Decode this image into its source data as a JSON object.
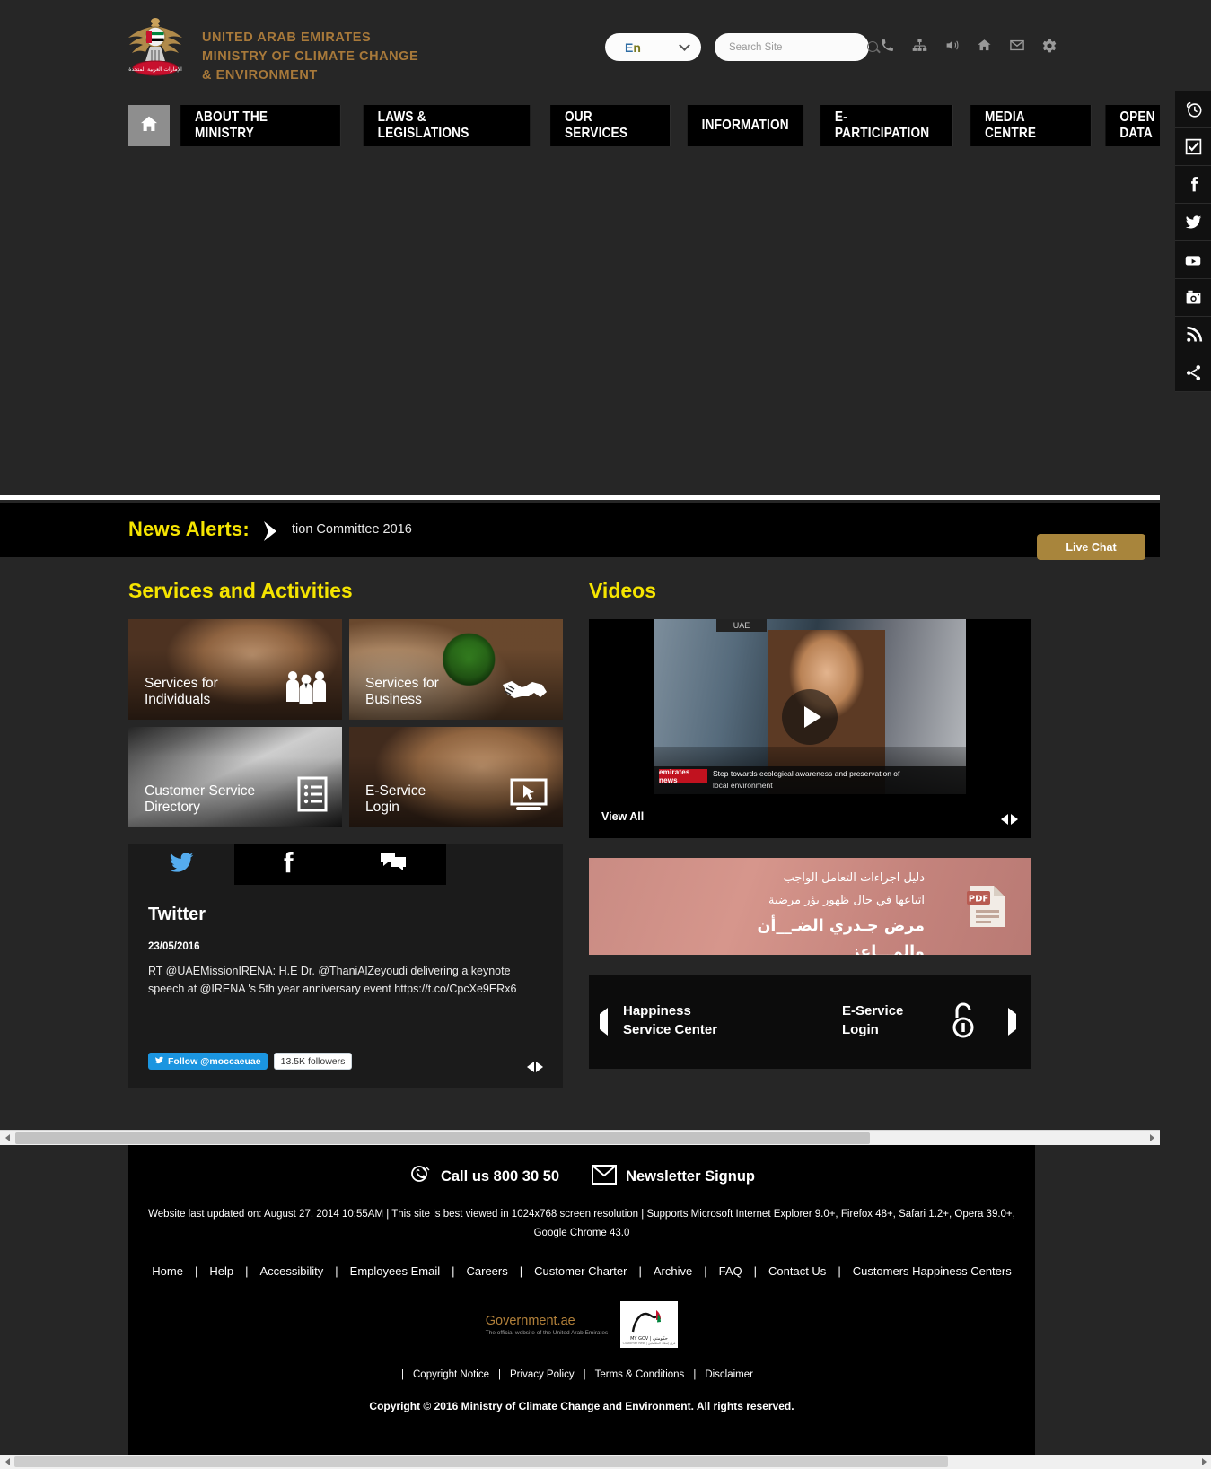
{
  "header": {
    "org_line1": "UNITED ARAB EMIRATES",
    "org_line2": "MINISTRY OF CLIMATE CHANGE",
    "org_line3": "& ENVIRONMENT",
    "language": "En",
    "language_e": "En",
    "search_placeholder": "Search Site",
    "search_value": "",
    "icons": [
      "phone-icon",
      "sitemap-icon",
      "accessibility-speaker-icon",
      "home-icon",
      "email-icon",
      "settings-gear-icon"
    ]
  },
  "nav": {
    "home_icon": "home-icon",
    "items": [
      {
        "label": "ABOUT THE MINISTRY"
      },
      {
        "label": "LAWS & LEGISLATIONS"
      },
      {
        "label": "OUR SERVICES"
      },
      {
        "label": "INFORMATION"
      },
      {
        "label": "E-PARTICIPATION"
      },
      {
        "label": "MEDIA CENTRE"
      },
      {
        "label": "OPEN DATA"
      }
    ]
  },
  "social_rail": [
    {
      "name": "prayer-times-clock-icon"
    },
    {
      "name": "survey-checkbox-icon"
    },
    {
      "name": "facebook-icon"
    },
    {
      "name": "twitter-icon"
    },
    {
      "name": "youtube-icon"
    },
    {
      "name": "instagram-icon"
    },
    {
      "name": "rss-icon"
    },
    {
      "name": "share-icon"
    }
  ],
  "news_alerts": {
    "label": "News Alerts:",
    "ticker_text": "tion Committee 2016",
    "live_chat": "Live Chat"
  },
  "services": {
    "title": "Services and Activities",
    "tiles": [
      {
        "line1": "Services for",
        "line2": "Individuals",
        "icon": "people-group-icon",
        "bg": "bg-hands-kb"
      },
      {
        "line1": "Services for",
        "line2": "Business",
        "icon": "handshake-icon",
        "bg": "bg-globe"
      },
      {
        "line1": "Customer Service",
        "line2": "Directory",
        "icon": "list-document-icon",
        "bg": "bg-kbpoint"
      },
      {
        "line1": "E-Service",
        "line2": "Login",
        "icon": "monitor-cursor-icon",
        "bg": "bg-hands-kb2"
      }
    ]
  },
  "social_widget": {
    "tabs": [
      {
        "icon": "twitter-icon",
        "active": true
      },
      {
        "icon": "facebook-icon",
        "active": false
      },
      {
        "icon": "chat-bubbles-icon",
        "active": false
      }
    ],
    "title": "Twitter",
    "date": "23/05/2016",
    "tweet": "RT @UAEMissionIRENA: H.E Dr. @ThaniAlZeyoudi delivering a keynote speech at @IRENA 's 5th year anniversary event https://t.co/CpcXe9ERx6",
    "follow_label": "Follow @moccaeuae",
    "followers": "13.5K followers"
  },
  "videos": {
    "title": "Videos",
    "view_all": "View All",
    "play_icon": "play-icon",
    "ticker_channel": "emirates news",
    "ticker_line1": "Step towards ecological awareness and preservation of",
    "ticker_line2": "local environment",
    "top_label": "UAE"
  },
  "pdf_banner": {
    "line1": "دليل اجراءات التعامل الواجب",
    "line2": "اتباعها في حال ظهور بؤر مرضية",
    "line3": "مرض جـدري الضـ__أن",
    "line4": "والمـــاعز",
    "icon": "pdf-document-icon"
  },
  "bottom_carousel": [
    {
      "line1": "Happiness",
      "line2": "Service Center"
    },
    {
      "line1": "E-Service",
      "line2": "Login"
    }
  ],
  "footer": {
    "call_label": "Call us 800 30 50",
    "call_icon": "phone-ring-icon",
    "newsletter_label": "Newsletter Signup",
    "newsletter_icon": "envelope-icon",
    "note": "Website last updated on: August 27, 2014 10:55AM | This site is best viewed in 1024x768 screen resolution | Supports Microsoft Internet Explorer 9.0+, Firefox 48+, Safari 1.2+, Opera 39.0+, Google Chrome 43.0",
    "links": [
      "Home",
      "Help",
      "Accessibility",
      "Employees Email",
      "Careers",
      "Customer Charter",
      "Archive",
      "FAQ",
      "Contact Us",
      "Customers Happiness Centers"
    ],
    "gov_logo_title": "Government.ae",
    "gov_logo_sub": "The official website of the United Arab Emirates",
    "mygov_logo": "mygov-uae-logo",
    "legal_links": [
      "Copyright Notice",
      "Privacy Policy",
      "Terms & Conditions",
      "Disclaimer"
    ],
    "copyright": "Copyright © 2016 Ministry of Climate Change and Environment. All rights reserved."
  },
  "colors": {
    "accent_gold": "#a8853c",
    "brand_gold": "#a8793a",
    "yellow": "#f5e400",
    "twitter_blue": "#1b95e0",
    "page_bg": "#262626",
    "black": "#000000"
  }
}
